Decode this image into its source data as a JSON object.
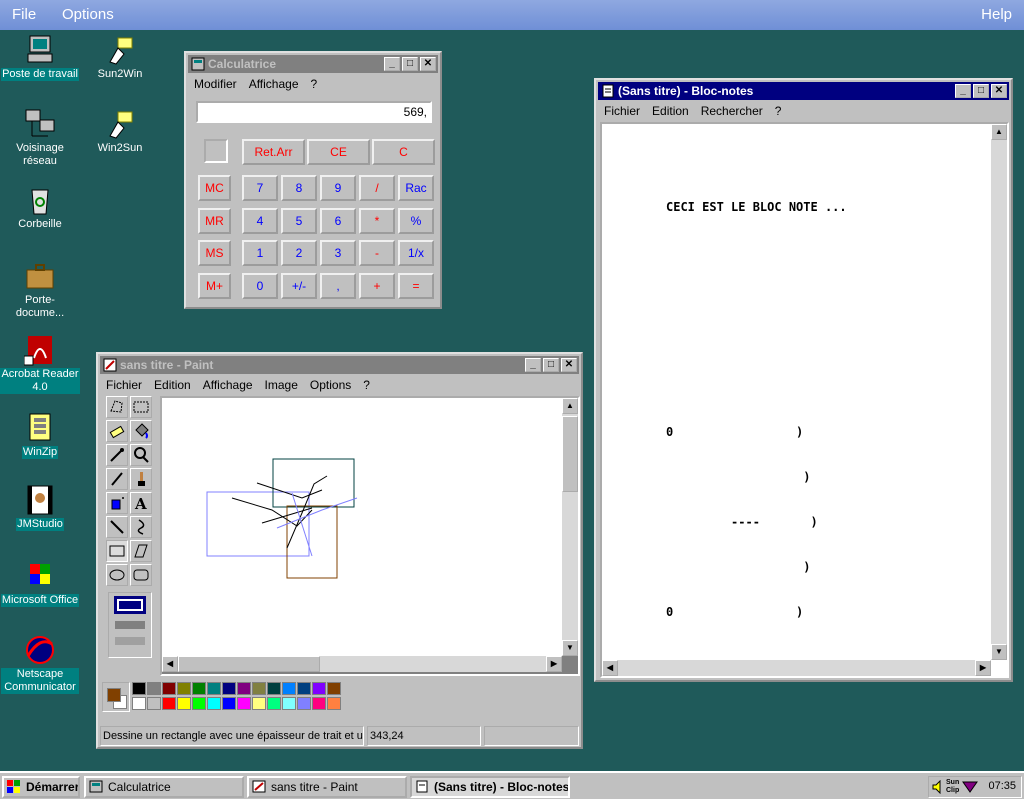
{
  "hostbar": {
    "file": "File",
    "options": "Options",
    "help": "Help"
  },
  "desktop": {
    "icons": [
      {
        "label": "Poste de travail",
        "icon": "computer-icon"
      },
      {
        "label": "Sun2Win",
        "icon": "sun2win-icon"
      },
      {
        "label": "Voisinage réseau",
        "icon": "network-icon"
      },
      {
        "label": "Win2Sun",
        "icon": "win2sun-icon"
      },
      {
        "label": "Corbeille",
        "icon": "recycle-bin-icon"
      },
      {
        "label": "Porte-docume...",
        "icon": "briefcase-icon"
      },
      {
        "label": "Acrobat Reader 4.0",
        "icon": "acrobat-icon"
      },
      {
        "label": "WinZip",
        "icon": "winzip-icon"
      },
      {
        "label": "JMStudio",
        "icon": "jmstudio-icon"
      },
      {
        "label": "Microsoft Office",
        "icon": "office-icon"
      },
      {
        "label": "Netscape Communicator",
        "icon": "netscape-icon"
      }
    ]
  },
  "calculator": {
    "title": "Calculatrice",
    "menu": [
      "Modifier",
      "Affichage",
      "?"
    ],
    "display": "569,",
    "top_buttons": [
      "Ret.Arr",
      "CE",
      "C"
    ],
    "memory_buttons": [
      "MC",
      "MR",
      "MS",
      "M+"
    ],
    "rows": [
      [
        "7",
        "8",
        "9",
        "/",
        "Rac"
      ],
      [
        "4",
        "5",
        "6",
        "*",
        "%"
      ],
      [
        "1",
        "2",
        "3",
        "-",
        "1/x"
      ],
      [
        "0",
        "+/-",
        ",",
        "+",
        "="
      ]
    ]
  },
  "paint": {
    "title": "sans titre - Paint",
    "menu": [
      "Fichier",
      "Edition",
      "Affichage",
      "Image",
      "Options",
      "?"
    ],
    "status_text": "Dessine un rectangle avec une épaisseur de trait et un",
    "coords": "343,24",
    "palette_top": [
      "#000000",
      "#808080",
      "#800000",
      "#808000",
      "#008000",
      "#008080",
      "#000080",
      "#800080",
      "#808040",
      "#004040",
      "#0080ff",
      "#004080",
      "#8000ff",
      "#804000"
    ],
    "palette_bottom": [
      "#ffffff",
      "#c0c0c0",
      "#ff0000",
      "#ffff00",
      "#00ff00",
      "#00ffff",
      "#0000ff",
      "#ff00ff",
      "#ffff80",
      "#00ff80",
      "#80ffff",
      "#8080ff",
      "#ff0080",
      "#ff8040"
    ],
    "fg_color": "#804000",
    "bg_color": "#ffffff"
  },
  "notepad": {
    "title": "(Sans titre) - Bloc-notes",
    "menu": [
      "Fichier",
      "Edition",
      "Rechercher",
      "?"
    ],
    "lines": [
      "CECI EST LE BLOC NOTE ...",
      "0                 )",
      "                   )",
      "         ----       )",
      "                   )",
      "0                 )"
    ]
  },
  "taskbar": {
    "start": "Démarrer",
    "tasks": [
      "Calculatrice",
      "sans titre - Paint",
      "(Sans titre) - Bloc-notes"
    ],
    "tray_label": "Sun Clip",
    "clock": "07:35"
  }
}
